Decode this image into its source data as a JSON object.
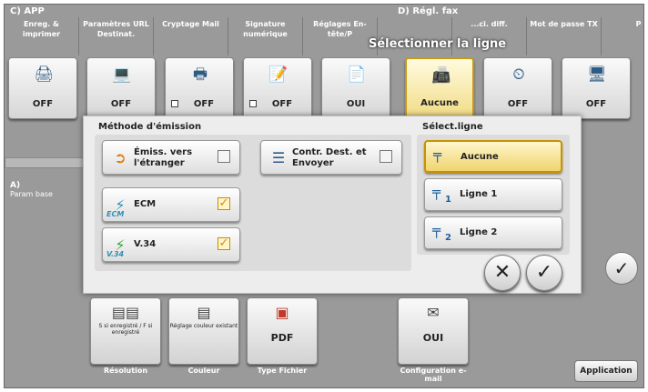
{
  "header": {
    "left_section": "C) APP",
    "right_section": "D) Régl. fax"
  },
  "tabs": [
    {
      "label": "Enreg. & imprimer"
    },
    {
      "label": "Paramètres URL Destinat."
    },
    {
      "label": "Cryptage Mail"
    },
    {
      "label": "Signature numérique"
    },
    {
      "label": "Réglages En-tête/P"
    },
    {
      "label": ""
    },
    {
      "label": "...ci. diff."
    },
    {
      "label": "Mot de passe TX"
    },
    {
      "label": "P"
    }
  ],
  "tiles": [
    {
      "value": "OFF",
      "icon": "save-print-icon",
      "glyph": "🖨"
    },
    {
      "value": "OFF",
      "icon": "url-destination-icon",
      "glyph": "💻"
    },
    {
      "value": "OFF",
      "icon": "encrypt-mail-icon",
      "glyph": "🖶"
    },
    {
      "value": "OFF",
      "icon": "digital-signature-icon",
      "glyph": "📝"
    },
    {
      "value": "OUI",
      "icon": "header-footer-icon",
      "glyph": "📄"
    },
    {
      "value": "Aucune",
      "icon": "line-select-icon",
      "glyph": "📠"
    },
    {
      "value": "OFF",
      "icon": "timer-icon",
      "glyph": "⏲"
    },
    {
      "value": "OFF",
      "icon": "password-tx-icon",
      "glyph": "🖥"
    }
  ],
  "left_panel": {
    "title": "A)",
    "subtitle": "Param base"
  },
  "dialog": {
    "title": "Sélectionner la ligne",
    "method_group_title": "Méthode d'émission",
    "options": {
      "overseas": {
        "label": "Émiss. vers l'étranger",
        "checked": false
      },
      "confirm_dest": {
        "label": "Contr. Dest. et Envoyer",
        "checked": false
      },
      "ecm": {
        "label": "ECM",
        "icon_label": "ECM",
        "checked": true
      },
      "v34": {
        "label": "V.34",
        "icon_label": "V.34",
        "checked": true
      }
    },
    "line_group_title": "Sélect.ligne",
    "lines": [
      {
        "label": "Aucune",
        "num": "",
        "selected": true
      },
      {
        "label": "Ligne 1",
        "num": "1",
        "selected": false
      },
      {
        "label": "Ligne 2",
        "num": "2",
        "selected": false
      }
    ],
    "cancel_glyph": "✕",
    "ok_glyph": "✓"
  },
  "bottom": {
    "tiles": [
      {
        "small": "S si enregistré / F si enregistré",
        "caption": "Résolution"
      },
      {
        "small": "Réglage couleur existant",
        "caption": "Couleur"
      },
      {
        "value": "PDF",
        "caption": "Type Fichier"
      },
      {
        "value": "OUI",
        "caption": "Configuration e-mail"
      }
    ],
    "application_button": "Application",
    "right_ok": "✓"
  },
  "colors": {
    "background": "#9a9a9a",
    "selected_fill": "#f2dc86",
    "selected_border": "#c89a10",
    "checkbox_on": "#d48c00"
  }
}
